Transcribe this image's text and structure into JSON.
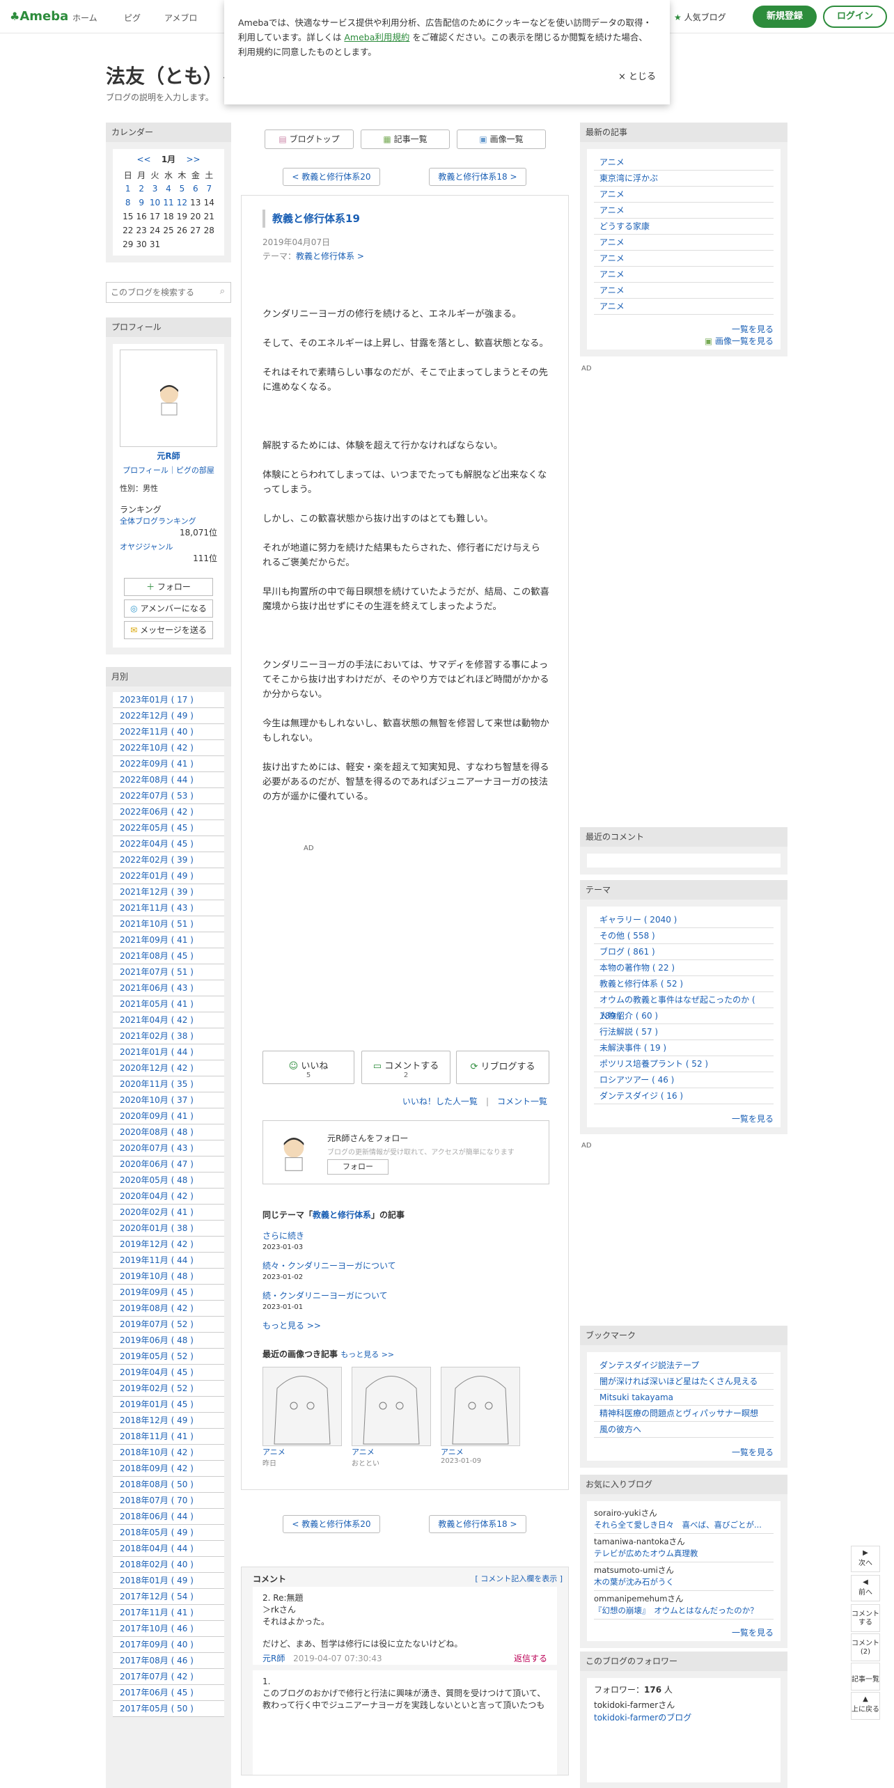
{
  "header": {
    "logo": "Ameba",
    "nav": [
      "ホーム",
      "ピグ",
      "アメブロ"
    ],
    "popular": "人気ブログ",
    "register": "新規登録",
    "login": "ログイン"
  },
  "cookie": {
    "text1": "Amebaでは、快適なサービス提供や利用分析、広告配信のためにクッキーなどを使い訪問データの取得・利用しています。詳しくは",
    "link": "Ameba利用規約",
    "text2": "をご確認ください。この表示を閉じるか閲覧を続けた場合、利用規約に同意したものとします。",
    "close": "× とじる"
  },
  "blog": {
    "title": "法友（とも）へ",
    "desc": "ブログの説明を入力します。"
  },
  "calendar": {
    "head": "カレンダー",
    "prev": "<<",
    "month": "1月",
    "next": ">>",
    "dow": [
      "日",
      "月",
      "火",
      "水",
      "木",
      "金",
      "土"
    ],
    "weeks": [
      [
        "1",
        "2",
        "3",
        "4",
        "5",
        "6",
        "7"
      ],
      [
        "8",
        "9",
        "10",
        "11",
        "12",
        "13",
        "14"
      ],
      [
        "15",
        "16",
        "17",
        "18",
        "19",
        "20",
        "21"
      ],
      [
        "22",
        "23",
        "24",
        "25",
        "26",
        "27",
        "28"
      ],
      [
        "29",
        "30",
        "31",
        "",
        "",
        "",
        ""
      ]
    ]
  },
  "search": {
    "placeholder": "このブログを検索する"
  },
  "profile": {
    "head": "プロフィール",
    "name": "元R師",
    "links": "プロフィール｜ピグの部屋",
    "gender": "性別：男性",
    "rank": "ランキング",
    "rank1": "全体ブログランキング",
    "rank1v": "18,071位",
    "rank2": "オヤジジャンル",
    "rank2v": "111位",
    "follow": "フォロー",
    "member": "アメンバーになる",
    "msg": "メッセージを送る"
  },
  "monthly": {
    "head": "月別",
    "items": [
      "2023年01月 ( 17 )",
      "2022年12月 ( 49 )",
      "2022年11月 ( 40 )",
      "2022年10月 ( 42 )",
      "2022年09月 ( 41 )",
      "2022年08月 ( 44 )",
      "2022年07月 ( 53 )",
      "2022年06月 ( 42 )",
      "2022年05月 ( 45 )",
      "2022年04月 ( 45 )",
      "2022年02月 ( 39 )",
      "2022年01月 ( 49 )",
      "2021年12月 ( 39 )",
      "2021年11月 ( 43 )",
      "2021年10月 ( 51 )",
      "2021年09月 ( 41 )",
      "2021年08月 ( 45 )",
      "2021年07月 ( 51 )",
      "2021年06月 ( 43 )",
      "2021年05月 ( 41 )",
      "2021年04月 ( 42 )",
      "2021年02月 ( 38 )",
      "2021年01月 ( 44 )",
      "2020年12月 ( 42 )",
      "2020年11月 ( 35 )",
      "2020年10月 ( 37 )",
      "2020年09月 ( 41 )",
      "2020年08月 ( 48 )",
      "2020年07月 ( 43 )",
      "2020年06月 ( 47 )",
      "2020年05月 ( 48 )",
      "2020年04月 ( 42 )",
      "2020年02月 ( 41 )",
      "2020年01月 ( 38 )",
      "2019年12月 ( 42 )",
      "2019年11月 ( 44 )",
      "2019年10月 ( 48 )",
      "2019年09月 ( 45 )",
      "2019年08月 ( 42 )",
      "2019年07月 ( 52 )",
      "2019年06月 ( 48 )",
      "2019年05月 ( 52 )",
      "2019年04月 ( 45 )",
      "2019年02月 ( 52 )",
      "2019年01月 ( 45 )",
      "2018年12月 ( 49 )",
      "2018年11月 ( 41 )",
      "2018年10月 ( 42 )",
      "2018年09月 ( 42 )",
      "2018年08月 ( 50 )",
      "2018年07月 ( 70 )",
      "2018年06月 ( 44 )",
      "2018年05月 ( 49 )",
      "2018年04月 ( 44 )",
      "2018年02月 ( 40 )",
      "2018年01月 ( 49 )",
      "2017年12月 ( 54 )",
      "2017年11月 ( 41 )",
      "2017年10月 ( 46 )",
      "2017年09月 ( 40 )",
      "2017年08月 ( 46 )",
      "2017年07月 ( 42 )",
      "2017年06月 ( 45 )",
      "2017年05月 ( 50 )"
    ]
  },
  "topnav": {
    "top": "ブログトップ",
    "list": "記事一覧",
    "img": "画像一覧",
    "prev": "< 教義と修行体系20",
    "next": "教義と修行体系18 >"
  },
  "article": {
    "title": "教義と修行体系19",
    "date": "2019年04月07日",
    "theme": "テーマ：",
    "theme_link": "教義と修行体系 >",
    "paras": [
      "クンダリニーヨーガの修行を続けると、エネルギーが強まる。",
      "そして、そのエネルギーは上昇し、甘露を落とし、歓喜状態となる。",
      "それはそれで素晴らしい事なのだが、そこで止まってしまうとその先に進めなくなる。",
      "",
      "解脱するためには、体験を超えて行かなければならない。",
      "体験にとらわれてしまっては、いつまでたっても解脱など出来なくなってしまう。",
      "しかし、この歓喜状態から抜け出すのはとても難しい。",
      "それが地道に努力を続けた結果もたらされた、修行者にだけ与えられるご褒美だからだ。",
      "早川も拘置所の中で毎日瞑想を続けていたようだが、結局、この歓喜魔境から抜け出せずにその生涯を終えてしまったようだ。",
      "",
      "クンダリニーヨーガの手法においては、サマディを修習する事によってそこから抜け出すわけだが、そのやり方ではどれほど時間がかかるか分からない。",
      "今生は無理かもしれないし、歓喜状態の無智を修習して来世は動物かもしれない。",
      "抜け出すためには、軽安・楽を超えて知実知見、すなわち智慧を得る必要があるのだが、智慧を得るのであればジュニアーナヨーガの技法の方が遥かに優れている。"
    ],
    "ad": "AD",
    "like": "いいね",
    "like_n": "5",
    "comment": "コメントする",
    "comment_n": "2",
    "reblog": "リブログする",
    "liked_list": "いいね！した人一覧",
    "comment_list": "コメント一覧",
    "follow_text": "元R師さんをフォロー",
    "follow_sub": "ブログの更新情報が受け取れて、アクセスが簡単になります",
    "follow_btn": "フォロー",
    "same_theme_pre": "同じテーマ「",
    "same_theme": "教義と修行体系",
    "same_theme_post": "」の記事",
    "related": [
      {
        "t": "さらに続き",
        "d": "2023-01-03"
      },
      {
        "t": "続々・クンダリニーヨーガについて",
        "d": "2023-01-02"
      },
      {
        "t": "続・クンダリニーヨーガについて",
        "d": "2023-01-01"
      }
    ],
    "rel_more": "もっと見る >>",
    "img_head": "最近の画像つき記事",
    "img_more": "もっと見る >>",
    "imgs": [
      {
        "t": "アニメ",
        "d": "昨日"
      },
      {
        "t": "アニメ",
        "d": "おととい"
      },
      {
        "t": "アニメ",
        "d": "2023-01-09"
      }
    ]
  },
  "comments": {
    "head": "コメント",
    "show": "[ コメント記入欄を表示 ]",
    "c1_title": "2. Re:無題",
    "c1_l1": "＞rkさん",
    "c1_l2": "それはよかった。",
    "c1_l3": "だけど、まあ、哲学は修行には役に立たないけどね。",
    "c1_author": "元R師",
    "c1_date": "2019-04-07 07:30:43",
    "c1_reply": "返信する",
    "c2_title": "1.",
    "c2_l1": "このブログのおかげで修行と行法に興味が湧き、質問を受けつけて頂いて、",
    "c2_l2": "教わって行く中でジュニアーナヨーガを実践しないといと言って頂いたつも"
  },
  "recent": {
    "head": "最新の記事",
    "items": [
      "アニメ",
      "東京湾に浮かぶ",
      "アニメ",
      "アニメ",
      "どうする家康",
      "アニメ",
      "アニメ",
      "アニメ",
      "アニメ",
      "アニメ"
    ],
    "more": "一覧を見る",
    "more_img": "画像一覧を見る"
  },
  "recent_comments": {
    "head": "最近のコメント"
  },
  "themes": {
    "head": "テーマ",
    "items": [
      "ギャラリー ( 2040 )",
      "その他 ( 558 )",
      "ブログ ( 861 )",
      "本物の著作物 ( 22 )",
      "教義と修行体系 ( 52 )",
      "オウムの教義と事件はなぜ起こったのか ( 189 )",
      "人物紹介 ( 60 )",
      "行法解説 ( 57 )",
      "未解決事件 ( 19 )",
      "ポツリス培養プラント ( 52 )",
      "ロシアツアー ( 46 )",
      "ダンテスダイジ ( 16 )"
    ],
    "more": "一覧を見る"
  },
  "bookmarks": {
    "head": "ブックマーク",
    "items": [
      "ダンテスダイジ説法テープ",
      "闇が深ければ深いほど星はたくさん見える",
      "Mitsuki takayama",
      "精神科医療の問題点とヴィパッサナー瞑想",
      "風の彼方へ"
    ],
    "more": "一覧を見る"
  },
  "favorites": {
    "head": "お気に入りブログ",
    "items": [
      {
        "u": "sorairo-yukiさん",
        "t": "それら全て愛しき日々　喜べば、喜びごとが..."
      },
      {
        "u": "tamaniwa-nantokaさん",
        "t": "テレビが広めたオウム真理教"
      },
      {
        "u": "matsumoto-umiさん",
        "t": "木の葉が沈み石がうく"
      },
      {
        "u": "ommanipemehumさん",
        "t": "『幻想の崩壊』　オウムとはなんだったのか？"
      }
    ],
    "more": "一覧を見る"
  },
  "followers": {
    "head": "このブログのフォロワー",
    "count_label": "フォロワー：",
    "count": "176",
    "unit": "人",
    "u1": "tokidoki-farmerさん",
    "u1b": "tokidoki-farmerのブログ"
  },
  "rail": {
    "next": "次へ",
    "prev": "前へ",
    "comment": "コメントする",
    "comments": "コメント(2)",
    "list": "記事一覧",
    "top": "上に戻る"
  },
  "colors": {
    "accent": "#2d8c3c",
    "link": "#1a5fb4"
  }
}
